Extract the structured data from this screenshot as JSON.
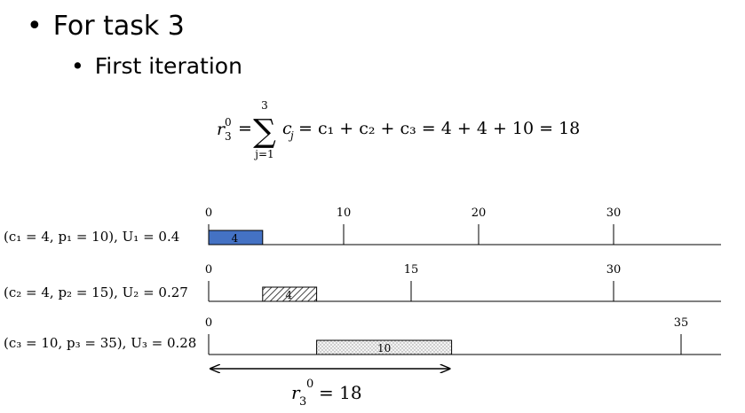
{
  "bullets": {
    "level1": "For task 3",
    "level2": "First iteration"
  },
  "formula": {
    "lhs_base": "r",
    "lhs_sub": "3",
    "lhs_sup": "0",
    "equals": "=",
    "sum_upper": "3",
    "sum_lower": "j=1",
    "sum_symbol": "∑",
    "term_base": "c",
    "term_sub": "j",
    "rhs": "= c₁ + c₂ + c₃ = 4 + 4 + 10 = 18"
  },
  "tasks": [
    {
      "label": "(c₁ = 4, p₁ = 10), U₁ = 0.4",
      "ticks": [
        0,
        10,
        20,
        30
      ],
      "period": 10,
      "block": {
        "start": 0,
        "end": 4,
        "label": "4",
        "fill": "solid",
        "color": "#4472c4"
      }
    },
    {
      "label": "(c₂ = 4, p₂ = 15), U₂ = 0.27",
      "ticks": [
        0,
        15,
        30
      ],
      "period": 15,
      "block": {
        "start": 4,
        "end": 8,
        "label": "4",
        "fill": "hatch",
        "color": "#555555"
      }
    },
    {
      "label": "(c₃ = 10, p₃ = 35), U₃ = 0.28",
      "ticks": [
        0,
        35
      ],
      "period": 35,
      "block": {
        "start": 8,
        "end": 18,
        "label": "10",
        "fill": "dots",
        "color": "#888888"
      }
    }
  ],
  "timeline": {
    "max": 38
  },
  "response": {
    "value": 18,
    "base": "r",
    "sub": "3",
    "sup": "0",
    "text": "= 18"
  }
}
